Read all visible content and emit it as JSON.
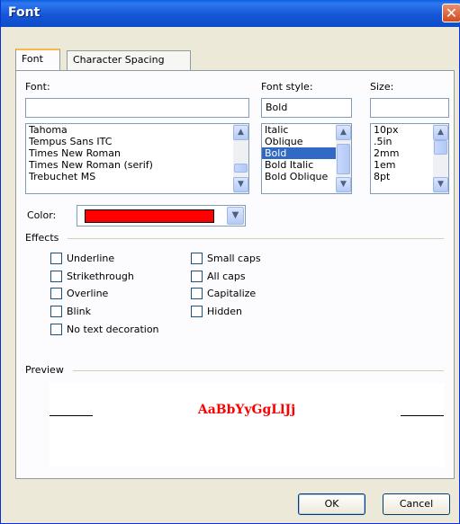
{
  "window": {
    "title": "Font",
    "close_symbol": "✕"
  },
  "tabs": [
    {
      "label": "Font"
    },
    {
      "label": "Character Spacing"
    }
  ],
  "font": {
    "label": "Font:",
    "value": "",
    "items": [
      "Tahoma",
      "Tempus Sans ITC",
      "Times New Roman",
      "Times New Roman (serif)",
      "Trebuchet MS"
    ]
  },
  "style": {
    "label": "Font style:",
    "value": "Bold",
    "items": [
      "Italic",
      "Oblique",
      "Bold",
      "Bold Italic",
      "Bold Oblique"
    ],
    "selected": "Bold"
  },
  "size": {
    "label": "Size:",
    "value": "",
    "items": [
      "10px",
      ".5in",
      "2mm",
      "1em",
      "8pt"
    ]
  },
  "color": {
    "label": "Color:",
    "value": "#ff0000"
  },
  "effects": {
    "label": "Effects",
    "left": [
      "Underline",
      "Strikethrough",
      "Overline",
      "Blink",
      "No text decoration"
    ],
    "right": [
      "Small caps",
      "All caps",
      "Capitalize",
      "Hidden"
    ]
  },
  "preview": {
    "label": "Preview",
    "sample": "AaBbYyGgLlJj",
    "color": "#ff0000"
  },
  "buttons": {
    "ok": "OK",
    "cancel": "Cancel"
  }
}
